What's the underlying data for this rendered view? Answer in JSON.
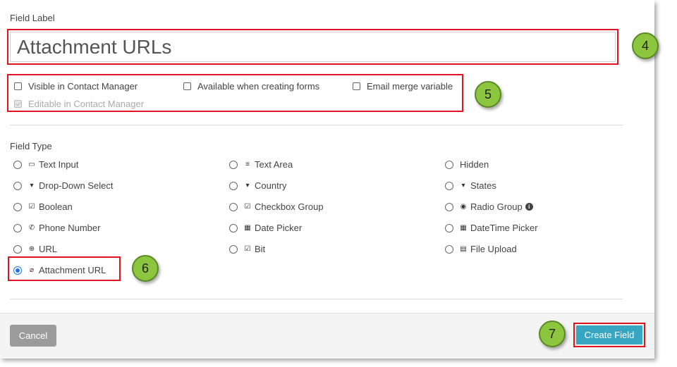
{
  "field_label": {
    "caption": "Field Label",
    "value": "Attachment URLs"
  },
  "options": {
    "visible_in_contact_manager": "Visible in Contact Manager",
    "available_when_creating_forms": "Available when creating forms",
    "email_merge_variable": "Email merge variable",
    "editable_in_contact_manager": "Editable in Contact Manager"
  },
  "field_type": {
    "caption": "Field Type",
    "types": [
      {
        "label": "Text Input",
        "icon": "text-input-icon"
      },
      {
        "label": "Text Area",
        "icon": "list-icon"
      },
      {
        "label": "Hidden",
        "icon": ""
      },
      {
        "label": "Drop-Down Select",
        "icon": "caret-square-icon"
      },
      {
        "label": "Country",
        "icon": "caret-square-icon"
      },
      {
        "label": "States",
        "icon": "caret-square-icon"
      },
      {
        "label": "Boolean",
        "icon": "check-square-icon"
      },
      {
        "label": "Checkbox Group",
        "icon": "check-square-icon"
      },
      {
        "label": "Radio Group",
        "icon": "dot-circle-icon"
      },
      {
        "label": "Phone Number",
        "icon": "phone-icon"
      },
      {
        "label": "Date Picker",
        "icon": "calendar-icon"
      },
      {
        "label": "DateTime Picker",
        "icon": "calendar-icon"
      },
      {
        "label": "URL",
        "icon": "globe-icon"
      },
      {
        "label": "Bit",
        "icon": "check-square-icon"
      },
      {
        "label": "File Upload",
        "icon": "file-icon"
      },
      {
        "label": "Attachment URL",
        "icon": "paperclip-icon"
      }
    ],
    "selected": "Attachment URL"
  },
  "callouts": [
    "4",
    "5",
    "6",
    "7"
  ],
  "buttons": {
    "cancel": "Cancel",
    "create": "Create Field"
  },
  "colors": {
    "highlight": "#e0141e",
    "callout": "#8cc63f",
    "create_button": "#36a6c3",
    "cancel_button": "#9b9b9b"
  }
}
